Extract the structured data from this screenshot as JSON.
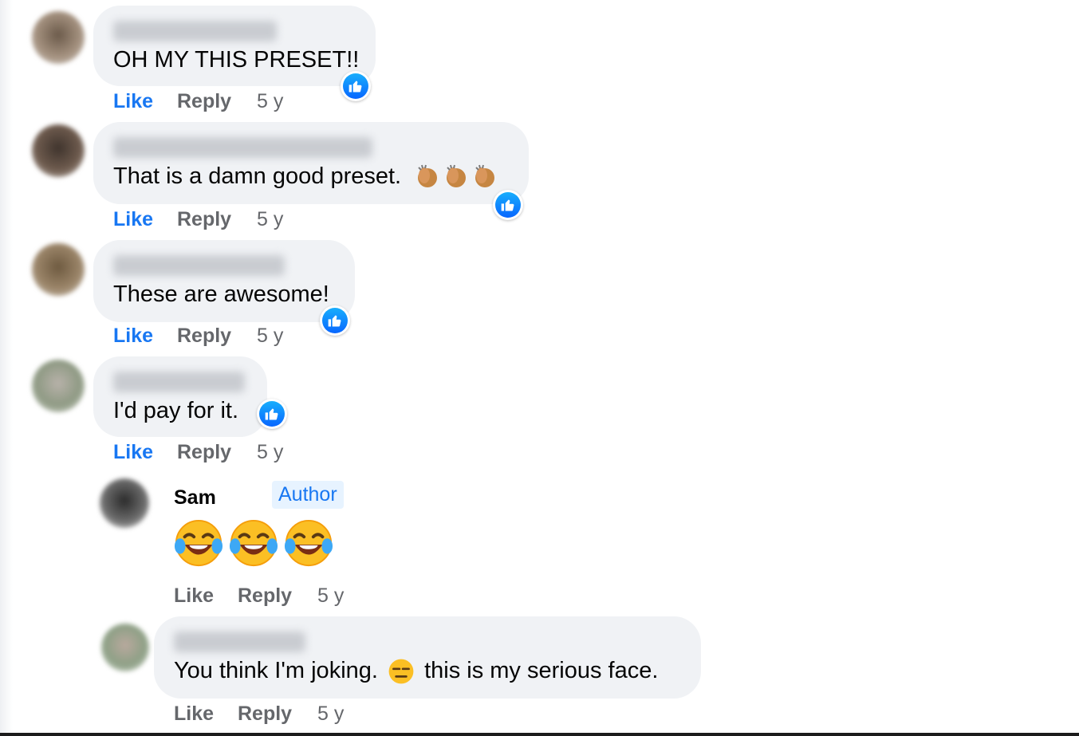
{
  "comments": [
    {
      "text": "OH MY THIS PRESET!!",
      "like": "Like",
      "reply": "Reply",
      "time": "5 y"
    },
    {
      "text": "That is a damn good preset.",
      "like": "Like",
      "reply": "Reply",
      "time": "5 y"
    },
    {
      "text": "These are awesome!",
      "like": "Like",
      "reply": "Reply",
      "time": "5 y"
    },
    {
      "text": "I'd pay for it.",
      "like": "Like",
      "reply": "Reply",
      "time": "5 y"
    }
  ],
  "author_reply": {
    "name": "Sam",
    "badge": "Author",
    "like": "Like",
    "reply": "Reply",
    "time": "5 y"
  },
  "last_reply": {
    "text_before": "You think I'm joking.",
    "text_after": "this is my serious face.",
    "like": "Like",
    "reply": "Reply",
    "time": "5 y"
  },
  "colors": {
    "bubble": "#f0f2f5",
    "like_active": "#1877f2",
    "meta_text": "#65676b",
    "author_badge_bg": "#e7f3ff"
  },
  "icons": {
    "reaction": "thumbs-up-icon",
    "clap": "clapping-hands-icon",
    "laugh": "tears-of-joy-icon",
    "serious": "expressionless-face-icon"
  }
}
